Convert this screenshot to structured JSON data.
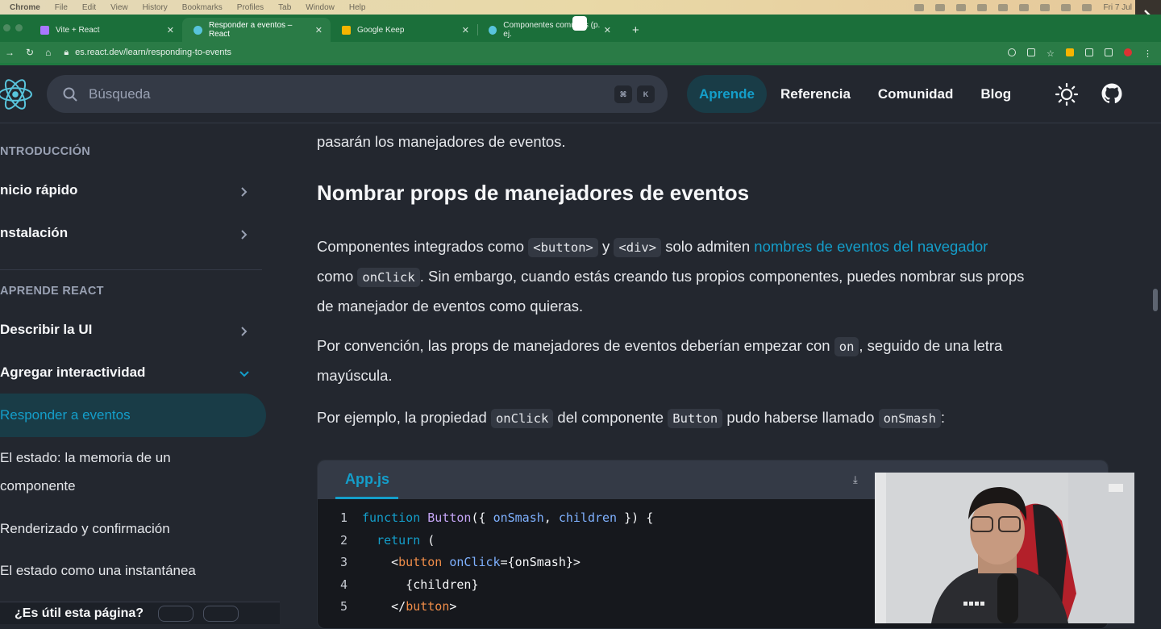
{
  "menubar": {
    "items": [
      "Chrome",
      "File",
      "Edit",
      "View",
      "History",
      "Bookmarks",
      "Profiles",
      "Tab",
      "Window",
      "Help"
    ],
    "clock": "Fri 7 Jul"
  },
  "tabs": [
    {
      "title": "Vite + React",
      "color": "#a877ff"
    },
    {
      "title": "Responder a eventos – React",
      "color": "#58c4dc"
    },
    {
      "title": "Google Keep",
      "color": "#f6b400"
    },
    {
      "title": "Componentes comunes (p. ej.",
      "color": "#58c4dc"
    }
  ],
  "address": {
    "url": "es.react.dev/learn/responding-to-events",
    "host": "es.react.dev",
    "path": "/learn/responding-to-events"
  },
  "search": {
    "placeholder": "Búsqueda",
    "key1": "⌘",
    "key2": "K"
  },
  "nav": {
    "learn": "Aprende",
    "reference": "Referencia",
    "community": "Comunidad",
    "blog": "Blog"
  },
  "sidebar": {
    "intro_heading": "NTRODUCCIÓN",
    "quick_start": "nicio rápido",
    "installation": "nstalación",
    "learn_heading": "APRENDE REACT",
    "describe_ui": "Describir la UI",
    "add_interactivity": "Agregar interactividad",
    "respond_events": "Responder a eventos",
    "state_memory_1": "El estado: la memoria de un",
    "state_memory_2": "componente",
    "render_commit": "Renderizado y confirmación",
    "state_snapshot": "El estado como una instantánea",
    "bottom_text": "¿Es útil esta página?"
  },
  "content": {
    "prev_line": "pasarán los manejadores de eventos.",
    "heading": "Nombrar props de manejadores de eventos",
    "p1_a": "Componentes integrados como ",
    "p1_code1": "<button>",
    "p1_b": " y ",
    "p1_code2": "<div>",
    "p1_c": " solo admiten ",
    "p1_link": "nombres de eventos del navegador",
    "p1_d": "como ",
    "p1_code3": "onClick",
    "p1_e": ". Sin embargo, cuando estás creando tus propios componentes, puedes nombrar sus props",
    "p1_f": "de manejador de eventos como quieras.",
    "p2_a": "Por convención, las props de manejadores de eventos deberían empezar con ",
    "p2_code": "on",
    "p2_b": ", seguido de una letra",
    "p2_c": "mayúscula.",
    "p3_a": "Por ejemplo, la propiedad ",
    "p3_code1": "onClick",
    "p3_b": " del componente ",
    "p3_code2": "Button",
    "p3_c": " pudo haberse llamado ",
    "p3_code3": "onSmash",
    "p3_d": ":"
  },
  "code": {
    "file": "App.js",
    "lines": [
      {
        "n": "1",
        "text": "function Button({ onSmash, children }) {"
      },
      {
        "n": "2",
        "text": "  return ("
      },
      {
        "n": "3",
        "text": "    <button onClick={onSmash}>"
      },
      {
        "n": "4",
        "text": "      {children}"
      },
      {
        "n": "5",
        "text": "    </button>"
      }
    ]
  },
  "colors": {
    "accent": "#149eca",
    "bg": "#23272f",
    "chrome": "#2a7b46"
  }
}
